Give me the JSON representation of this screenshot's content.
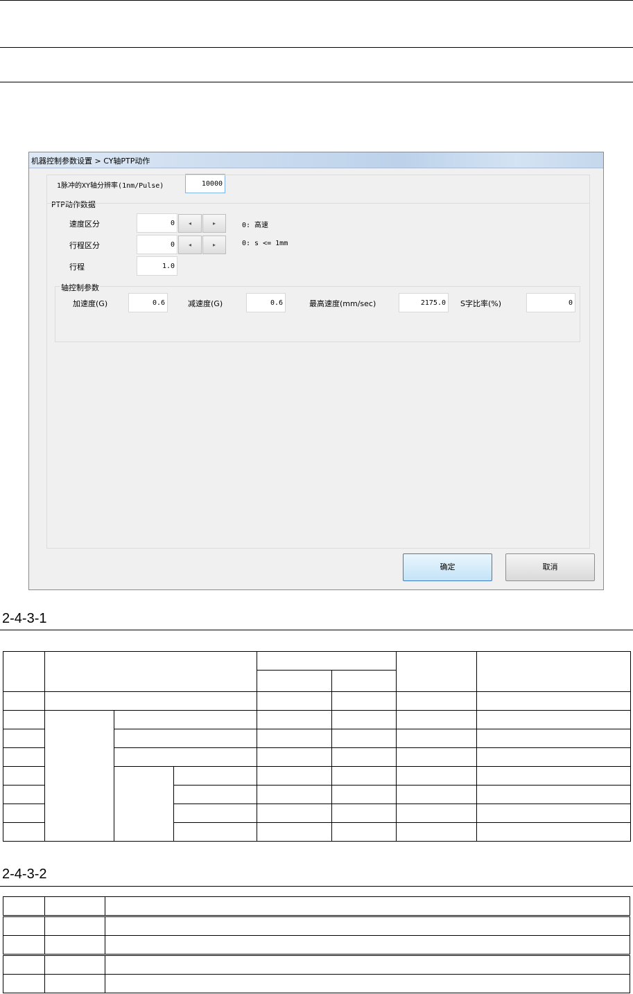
{
  "dialog": {
    "title": "机器控制参数设置 > CY轴PTP动作",
    "resolution": {
      "label": "1脉冲的XY轴分辨率(1nm/Pulse)",
      "value": "10000"
    },
    "ptp_group": {
      "title": "PTP动作数据",
      "speed_mode": {
        "label": "速度区分",
        "value": "0",
        "note": "0: 高速"
      },
      "stroke_mode": {
        "label": "行程区分",
        "value": "0",
        "note": "0: s <= 1mm"
      },
      "stroke": {
        "label": "行程",
        "value": "1.0"
      }
    },
    "axis_group": {
      "title": "轴控制参数",
      "accel": {
        "label": "加速度(G)",
        "value": "0.6"
      },
      "decel": {
        "label": "减速度(G)",
        "value": "0.6"
      },
      "max_speed": {
        "label": "最高速度(mm/sec)",
        "value": "2175.0"
      },
      "s_ratio": {
        "label": "S字比率(%)",
        "value": "0"
      }
    },
    "ok_label": "确定",
    "cancel_label": "取消",
    "spin_left_glyph": "◂",
    "spin_right_glyph": "▸"
  },
  "captions": {
    "table1": "2-4-3-1",
    "table2": "2-4-3-2"
  }
}
